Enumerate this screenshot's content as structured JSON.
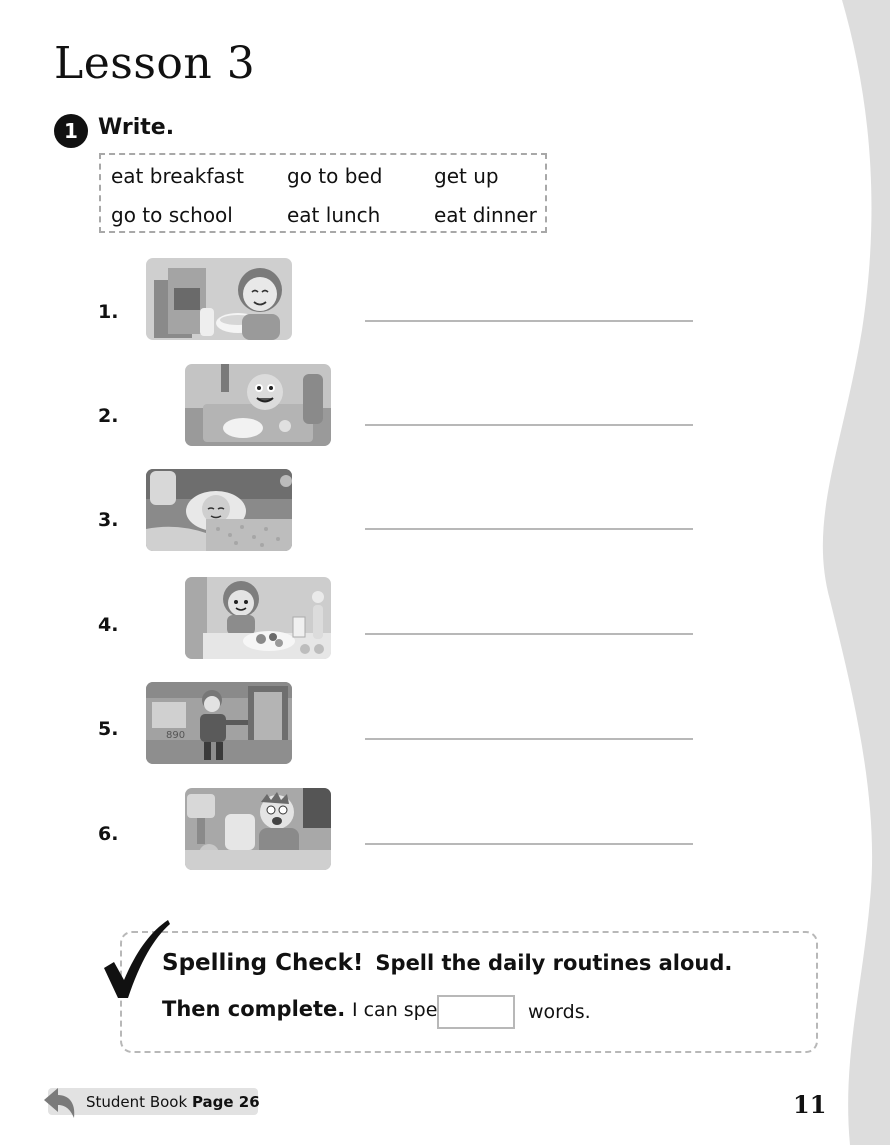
{
  "title": "Lesson 3",
  "exercise": {
    "number": "1",
    "instruction": "Write."
  },
  "word_bank": [
    "eat breakfast",
    "go to bed",
    "get up",
    "go to school",
    "eat lunch",
    "eat dinner"
  ],
  "items": [
    {
      "number": "1.",
      "picture": "girl-eating-cereal"
    },
    {
      "number": "2.",
      "picture": "cafeteria-lunch-tray"
    },
    {
      "number": "3.",
      "picture": "girl-in-bed"
    },
    {
      "number": "4.",
      "picture": "girl-at-dinner-table"
    },
    {
      "number": "5.",
      "picture": "boy-leaving-on-school-bus"
    },
    {
      "number": "6.",
      "picture": "boy-waking-up"
    }
  ],
  "spelling_check": {
    "title": "Spelling Check!",
    "instruction": "Spell the daily routines aloud.",
    "line2_bold": "Then complete.",
    "line2_text": "I can spell",
    "count_value": "",
    "suffix": "words."
  },
  "footer": {
    "ref_prefix": "Student Book",
    "ref_page": "Page 26",
    "page_number": "11"
  },
  "colors": {
    "side_band": "#dddddd",
    "dashed_border": "#a8a8a8",
    "answer_line": "#b8b8b8",
    "ref_tab": "#e2e2e2"
  }
}
